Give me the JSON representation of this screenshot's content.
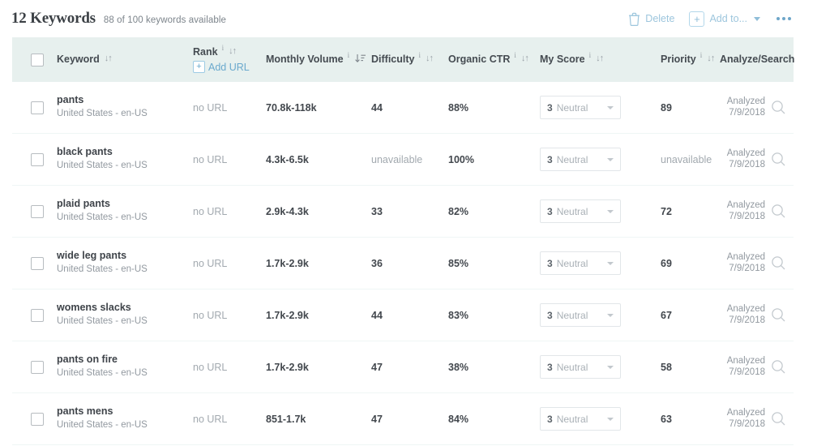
{
  "header": {
    "title": "12 Keywords",
    "subtitle": "88 of 100 keywords available",
    "delete_label": "Delete",
    "add_to_label": "Add to...",
    "more_label": "more-options"
  },
  "table": {
    "columns": {
      "keyword": "Keyword",
      "rank": "Rank",
      "add_url": "Add URL",
      "monthly_volume": "Monthly Volume",
      "difficulty": "Difficulty",
      "organic_ctr": "Organic CTR",
      "my_score": "My Score",
      "priority": "Priority",
      "analyze_search": "Analyze/Search"
    },
    "sort_glyph": "↓↑",
    "sort_glyph_active": "↓",
    "locale": "United States - en-US",
    "no_url": "no URL",
    "analyzed_label": "Analyzed",
    "rows": [
      {
        "keyword": "pants",
        "locale": "United States - en-US",
        "rank": "no URL",
        "monthly_volume": "70.8k-118k",
        "difficulty": "44",
        "organic_ctr": "88%",
        "score_value": "3",
        "score_label": "Neutral",
        "priority": "89",
        "analyzed_label": "Analyzed",
        "analyzed_date": "7/9/2018"
      },
      {
        "keyword": "black pants",
        "locale": "United States - en-US",
        "rank": "no URL",
        "monthly_volume": "4.3k-6.5k",
        "difficulty": "unavailable",
        "organic_ctr": "100%",
        "score_value": "3",
        "score_label": "Neutral",
        "priority": "unavailable",
        "analyzed_label": "Analyzed",
        "analyzed_date": "7/9/2018"
      },
      {
        "keyword": "plaid pants",
        "locale": "United States - en-US",
        "rank": "no URL",
        "monthly_volume": "2.9k-4.3k",
        "difficulty": "33",
        "organic_ctr": "82%",
        "score_value": "3",
        "score_label": "Neutral",
        "priority": "72",
        "analyzed_label": "Analyzed",
        "analyzed_date": "7/9/2018"
      },
      {
        "keyword": "wide leg pants",
        "locale": "United States - en-US",
        "rank": "no URL",
        "monthly_volume": "1.7k-2.9k",
        "difficulty": "36",
        "organic_ctr": "85%",
        "score_value": "3",
        "score_label": "Neutral",
        "priority": "69",
        "analyzed_label": "Analyzed",
        "analyzed_date": "7/9/2018"
      },
      {
        "keyword": "womens slacks",
        "locale": "United States - en-US",
        "rank": "no URL",
        "monthly_volume": "1.7k-2.9k",
        "difficulty": "44",
        "organic_ctr": "83%",
        "score_value": "3",
        "score_label": "Neutral",
        "priority": "67",
        "analyzed_label": "Analyzed",
        "analyzed_date": "7/9/2018"
      },
      {
        "keyword": "pants on fire",
        "locale": "United States - en-US",
        "rank": "no URL",
        "monthly_volume": "1.7k-2.9k",
        "difficulty": "47",
        "organic_ctr": "38%",
        "score_value": "3",
        "score_label": "Neutral",
        "priority": "58",
        "analyzed_label": "Analyzed",
        "analyzed_date": "7/9/2018"
      },
      {
        "keyword": "pants mens",
        "locale": "United States - en-US",
        "rank": "no URL",
        "monthly_volume": "851-1.7k",
        "difficulty": "47",
        "organic_ctr": "84%",
        "score_value": "3",
        "score_label": "Neutral",
        "priority": "63",
        "analyzed_label": "Analyzed",
        "analyzed_date": "7/9/2018"
      }
    ]
  },
  "colors": {
    "header_band": "#e7f0ee",
    "link_blue": "#6aa9cd",
    "muted_blue": "#9dc6dd",
    "text_dark": "#3f444a",
    "text_muted": "#9299a0",
    "row_divider": "#eff6f5"
  }
}
